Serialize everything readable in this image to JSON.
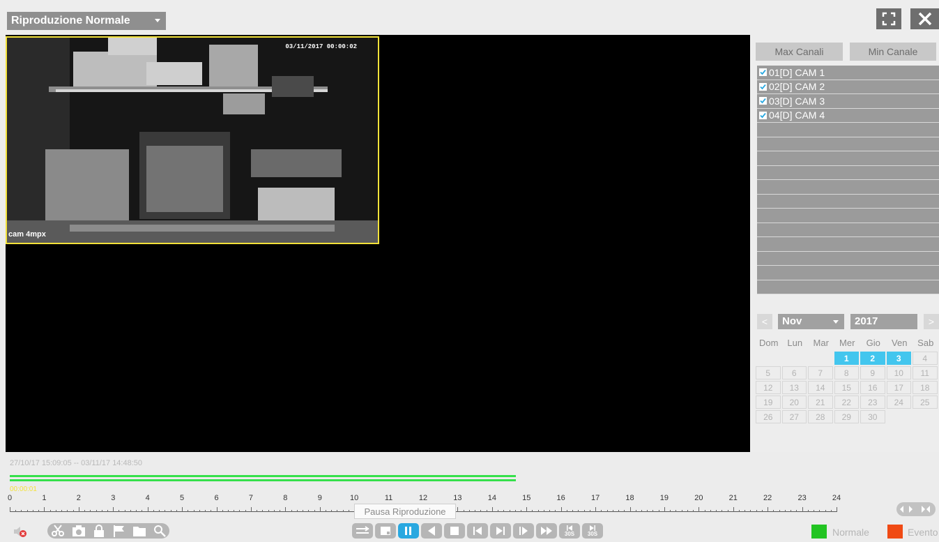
{
  "header": {
    "mode_label": "Riproduzione Normale",
    "fullscreen_icon": "fullscreen-icon",
    "close_icon": "close-icon"
  },
  "camera_tile": {
    "timestamp": "03/11/2017 00:00:02",
    "camera_name": "cam 4mpx"
  },
  "channels": {
    "max_label": "Max Canali",
    "min_label": "Min Canale",
    "items": [
      {
        "label": "01[D] CAM 1",
        "checked": true
      },
      {
        "label": "02[D] CAM 2",
        "checked": true
      },
      {
        "label": "03[D] CAM 3",
        "checked": true
      },
      {
        "label": "04[D] CAM 4",
        "checked": true
      }
    ]
  },
  "calendar": {
    "prev": "<",
    "next": ">",
    "month": "Nov",
    "year": "2017",
    "weekdays": [
      "Dom",
      "Lun",
      "Mar",
      "Mer",
      "Gio",
      "Ven",
      "Sab"
    ],
    "weeks": [
      [
        "",
        "",
        "",
        "1",
        "2",
        "3",
        "4"
      ],
      [
        "5",
        "6",
        "7",
        "8",
        "9",
        "10",
        "11"
      ],
      [
        "12",
        "13",
        "14",
        "15",
        "16",
        "17",
        "18"
      ],
      [
        "19",
        "20",
        "21",
        "22",
        "23",
        "24",
        "25"
      ],
      [
        "26",
        "27",
        "28",
        "29",
        "30",
        "",
        ""
      ]
    ],
    "recorded_days": [
      "1",
      "2",
      "3"
    ],
    "record_color": "#43c6ee"
  },
  "timeline": {
    "range": "27/10/17 15:09:05 -- 03/11/17 14:48:50",
    "current_time": "00:00:01",
    "hour_labels": [
      "0",
      "1",
      "2",
      "3",
      "4",
      "5",
      "6",
      "7",
      "8",
      "9",
      "10",
      "11",
      "12",
      "13",
      "14",
      "15",
      "16",
      "17",
      "18",
      "19",
      "20",
      "21",
      "22",
      "23",
      "24"
    ],
    "recording_end_hour": 14.7,
    "recording_color": "#35e04b"
  },
  "controls": {
    "tooltip": "Pausa Riproduzione",
    "skip_back_label": "30S",
    "skip_fwd_label": "30S",
    "active_color": "#29a8e0"
  },
  "legend": {
    "normal_label": "Normale",
    "normal_color": "#22c422",
    "event_label": "Evento",
    "event_color": "#f04a14"
  }
}
